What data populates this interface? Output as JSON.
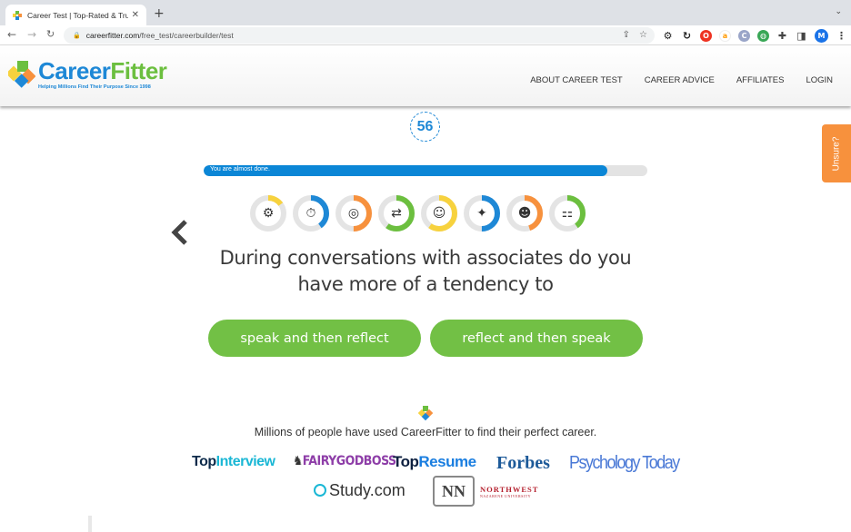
{
  "browser": {
    "tab_title": "Career Test | Top-Rated & Trusted",
    "url_domain": "careerfitter.com",
    "url_path": "/free_test/careerbuilder/test",
    "profile_initial": "M"
  },
  "header": {
    "logo_name_part1": "Career",
    "logo_name_part2": "Fitter",
    "logo_tagline": "Helping Millions Find Their Purpose Since 1998",
    "nav": [
      "ABOUT CAREER TEST",
      "CAREER ADVICE",
      "AFFILIATES",
      "LOGIN"
    ]
  },
  "quiz": {
    "question_number": "56",
    "progress_label": "You are almost done.",
    "progress_percent": 91,
    "categories": [
      {
        "icon": "people-network-icon",
        "glyph": "⚙",
        "color": "#f7d23e",
        "percent": 15
      },
      {
        "icon": "stopwatch-icon",
        "glyph": "⏱",
        "color": "#1e88d6",
        "percent": 40
      },
      {
        "icon": "target-icon",
        "glyph": "◎",
        "color": "#f7913d",
        "percent": 50
      },
      {
        "icon": "direction-arrows-icon",
        "glyph": "⇄",
        "color": "#6cbf3f",
        "percent": 60
      },
      {
        "icon": "head-speech-icon",
        "glyph": "☺",
        "color": "#f7d23e",
        "percent": 60
      },
      {
        "icon": "head-lightbulb-icon",
        "glyph": "✦",
        "color": "#1e88d6",
        "percent": 50
      },
      {
        "icon": "two-heads-icon",
        "glyph": "☻",
        "color": "#f7913d",
        "percent": 45
      },
      {
        "icon": "hierarchy-icon",
        "glyph": "⚏",
        "color": "#6cbf3f",
        "percent": 40
      }
    ],
    "question": "During conversations with associates do you have more of a tendency to",
    "answers": [
      "speak and then reflect",
      "reflect and then speak"
    ],
    "unsure_label": "Unsure?"
  },
  "footer": {
    "tagline": "Millions of people have used CareerFitter to find their perfect career.",
    "press": {
      "topinterview_1": "Top",
      "topinterview_2": "Interview",
      "fairygodboss": "FAIRYGODBOSS",
      "topresume_1": "Top",
      "topresume_2": "Resume",
      "forbes": "Forbes",
      "psychology_today": "Psychology Today",
      "study": "Study.com",
      "nnu_mark": "NN",
      "nnu_line1": "NORTHWEST",
      "nnu_line2": "NAZARENE UNIVERSITY"
    }
  }
}
